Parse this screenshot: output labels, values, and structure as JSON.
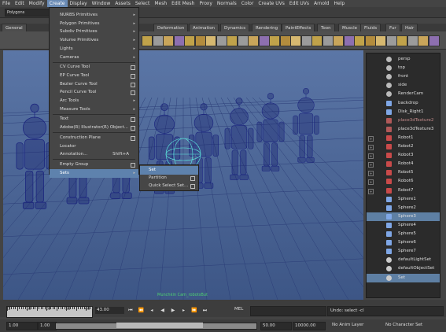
{
  "menubar": [
    "File",
    "Edit",
    "Modify",
    "Create",
    "Display",
    "Window",
    "Assets",
    "Select",
    "Mesh",
    "Edit Mesh",
    "Proxy",
    "Normals",
    "Color",
    "Create UVs",
    "Edit UVs",
    "Arnold",
    "Help"
  ],
  "mode": "Polygons",
  "shelf_tabs": [
    "General",
    "dvs",
    "Deformation",
    "Animation",
    "Dynamics",
    "Rendering",
    "PaintEffects",
    "Toon",
    "Muscle",
    "Fluids",
    "Fur",
    "Hair"
  ],
  "create_menu": [
    {
      "label": "NURBS Primitives",
      "arrow": true
    },
    {
      "label": "Polygon Primitives",
      "arrow": true
    },
    {
      "label": "Subdiv Primitives",
      "arrow": true
    },
    {
      "label": "Volume Primitives",
      "arrow": true
    },
    {
      "label": "Lights",
      "arrow": true
    },
    {
      "label": "Cameras",
      "arrow": true
    },
    {
      "label": "CV Curve Tool",
      "option": true
    },
    {
      "label": "EP Curve Tool",
      "option": true
    },
    {
      "label": "Bezier Curve Tool",
      "option": true
    },
    {
      "label": "Pencil Curve Tool",
      "option": true
    },
    {
      "label": "Arc Tools",
      "arrow": true
    },
    {
      "label": "Measure Tools",
      "arrow": true
    },
    {
      "label": "Text",
      "option": true
    },
    {
      "label": "Adobe(R) Illustrator(R) Object...",
      "option": true
    },
    {
      "label": "Construction Plane",
      "option": true
    },
    {
      "label": "Locator"
    },
    {
      "label": "Annotation...",
      "shortcut": "Shift+A"
    },
    {
      "label": "Empty Group",
      "option": true
    },
    {
      "label": "Sets",
      "arrow": true,
      "highlighted": true
    }
  ],
  "sets_submenu": [
    {
      "label": "Set",
      "highlighted": true
    },
    {
      "label": "Partition",
      "option": true
    },
    {
      "label": "Quick Select Set...",
      "option": true
    }
  ],
  "viewport_label": "Munchkin Cam_robotsBut",
  "outliner": [
    {
      "label": "persp",
      "expand": false,
      "icon": "camera-icon"
    },
    {
      "label": "top",
      "expand": false,
      "icon": "camera-icon"
    },
    {
      "label": "front",
      "expand": false,
      "icon": "camera-icon"
    },
    {
      "label": "side",
      "expand": false,
      "icon": "camera-icon"
    },
    {
      "label": "RenderCam",
      "expand": false,
      "icon": "camera-icon"
    },
    {
      "label": "backdrop",
      "expand": false,
      "icon": "mesh-icon"
    },
    {
      "label": "Disk_Right1",
      "expand": false,
      "icon": "light-icon"
    },
    {
      "label": "place3dTexture2",
      "expand": false,
      "icon": "texture-icon",
      "dim": true
    },
    {
      "label": "place3dTexture3",
      "expand": false,
      "icon": "texture-icon"
    },
    {
      "label": "Robot1",
      "expand": true,
      "icon": "group-icon"
    },
    {
      "label": "Robot2",
      "expand": true,
      "icon": "group-icon"
    },
    {
      "label": "Robot3",
      "expand": true,
      "icon": "group-icon"
    },
    {
      "label": "Robot4",
      "expand": true,
      "icon": "group-icon"
    },
    {
      "label": "Robot5",
      "expand": true,
      "icon": "group-icon"
    },
    {
      "label": "Robot6",
      "expand": true,
      "icon": "group-icon"
    },
    {
      "label": "Robot7",
      "expand": true,
      "icon": "group-icon"
    },
    {
      "label": "Sphere1",
      "expand": false,
      "icon": "mesh-icon"
    },
    {
      "label": "Sphere2",
      "expand": false,
      "icon": "mesh-icon"
    },
    {
      "label": "Sphere3",
      "expand": false,
      "icon": "mesh-icon",
      "selected": true
    },
    {
      "label": "Sphere4",
      "expand": false,
      "icon": "mesh-icon"
    },
    {
      "label": "Sphere5",
      "expand": false,
      "icon": "mesh-icon"
    },
    {
      "label": "Sphere6",
      "expand": false,
      "icon": "mesh-icon"
    },
    {
      "label": "Sphere7",
      "expand": false,
      "icon": "mesh-icon"
    },
    {
      "label": "defaultLightSet",
      "expand": false,
      "icon": "set-icon"
    },
    {
      "label": "defaultObjectSet",
      "expand": false,
      "icon": "set-icon"
    },
    {
      "label": "Set",
      "expand": false,
      "icon": "set-icon",
      "selected": true
    }
  ],
  "timeline": {
    "ruler_numbers": [
      "1",
      "10",
      "20",
      "30",
      "40"
    ],
    "current_frame": "43.00",
    "mel_label": "MEL",
    "feedback": "Undo: select -cl"
  },
  "range": {
    "start": "1.00",
    "start_playback": "1.00",
    "slider_value": "1",
    "end_playback": "50.00",
    "end": "10000.00",
    "anim_layer": "No Anim Layer",
    "character_set": "No Character Set"
  },
  "colors": {
    "wire": "#1a237e",
    "highlight_wire": "#5ef0e2",
    "selection": "#5e82ad"
  }
}
